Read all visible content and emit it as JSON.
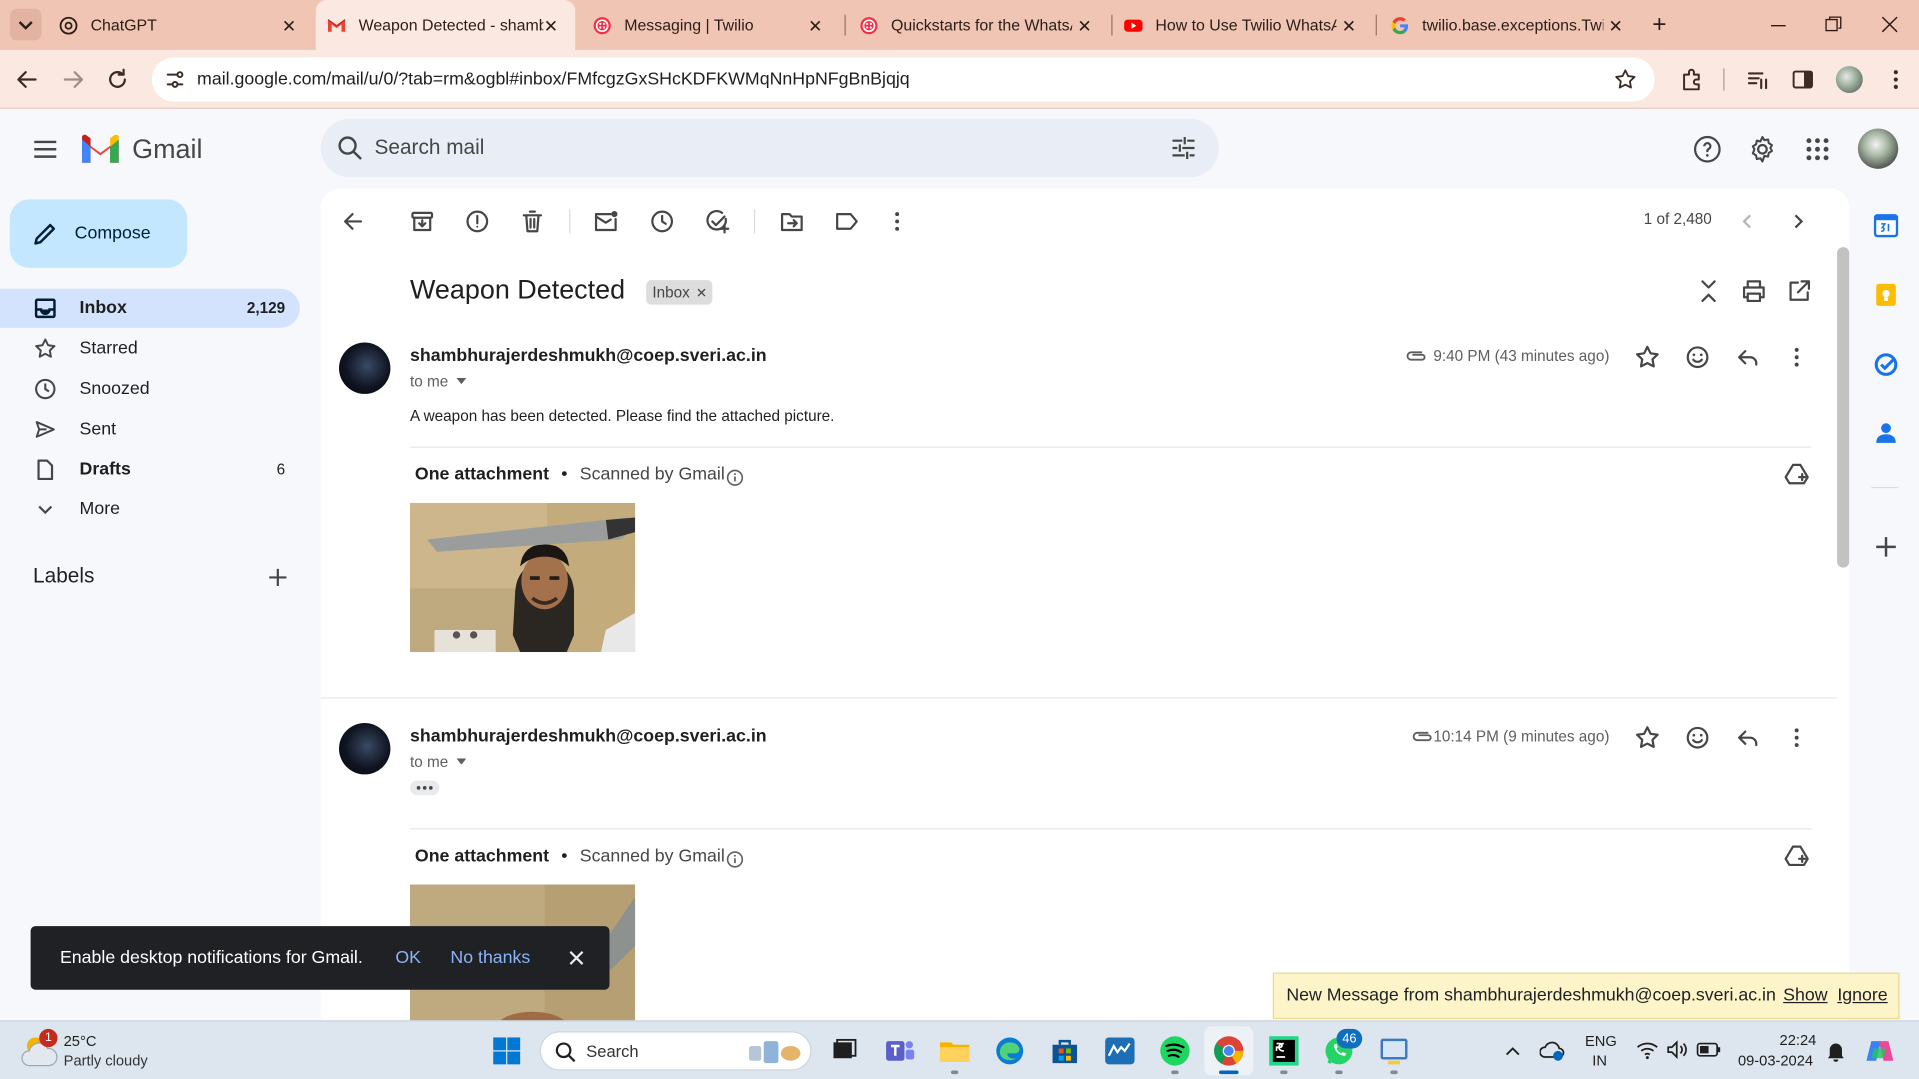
{
  "browser": {
    "tabs": [
      {
        "title": "ChatGPT",
        "icon": "chatgpt-icon"
      },
      {
        "title": "Weapon Detected - shamb",
        "icon": "gmail-icon",
        "active": true
      },
      {
        "title": "Messaging | Twilio",
        "icon": "twilio-icon"
      },
      {
        "title": "Quickstarts for the WhatsA",
        "icon": "twilio-icon"
      },
      {
        "title": "How to Use Twilio WhatsA",
        "icon": "youtube-icon"
      },
      {
        "title": "twilio.base.exceptions.Twili",
        "icon": "google-icon"
      }
    ],
    "url": "mail.google.com/mail/u/0/?tab=rm&ogbl#inbox/FMfcgzGxSHcKDFKWMqNnHpNFgBnBjqjq"
  },
  "gmail": {
    "logo_text": "Gmail",
    "search_placeholder": "Search mail",
    "compose_label": "Compose",
    "nav": [
      {
        "label": "Inbox",
        "count": "2,129",
        "icon": "inbox-icon"
      },
      {
        "label": "Starred",
        "count": "",
        "icon": "star-icon"
      },
      {
        "label": "Snoozed",
        "count": "",
        "icon": "clock-icon"
      },
      {
        "label": "Sent",
        "count": "",
        "icon": "send-icon"
      },
      {
        "label": "Drafts",
        "count": "6",
        "icon": "draft-icon"
      },
      {
        "label": "More",
        "count": "",
        "icon": "chevron-down-icon"
      }
    ],
    "labels_heading": "Labels",
    "page_count": "1 of 2,480",
    "subject": "Weapon Detected",
    "subject_chip": "Inbox",
    "messages": [
      {
        "sender": "shambhurajerdeshmukh@coep.sveri.ac.in",
        "to": "to me",
        "time": "9:40 PM (43 minutes ago)",
        "body": "A weapon has been detected. Please find the attached picture.",
        "attachment_title": "One attachment",
        "scanned": "Scanned by Gmail"
      },
      {
        "sender": "shambhurajerdeshmukh@coep.sveri.ac.in",
        "to": "to me",
        "time": "10:14 PM (9 minutes ago)",
        "body": "",
        "attachment_title": "One attachment",
        "scanned": "Scanned by Gmail"
      }
    ],
    "toast": {
      "text": "Enable desktop notifications for Gmail.",
      "ok": "OK",
      "no_thanks": "No thanks"
    },
    "popup": {
      "text": "New Message from shambhurajerdeshmukh@coep.sveri.ac.in",
      "show": "Show",
      "ignore": "Ignore"
    }
  },
  "taskbar": {
    "weather_temp": "25°C",
    "weather_desc": "Partly cloudy",
    "weather_badge": "1",
    "search_label": "Search",
    "whatsapp_badge": "46",
    "lang_line1": "ENG",
    "lang_line2": "IN",
    "time": "22:24",
    "date": "09-03-2024"
  },
  "colors": {
    "tabstrip": "#f0c5b4",
    "toolbar": "#fbe8e1",
    "gmail_bg": "#f6f8fc",
    "inbox_selected": "#d3e3fd",
    "compose": "#c2e7ff",
    "toast": "#202124",
    "toast_link": "#8ab4f8",
    "popup": "#fdf5c9"
  }
}
